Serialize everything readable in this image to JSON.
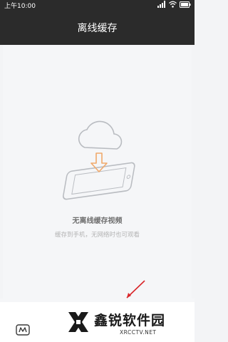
{
  "status_bar": {
    "time": "上午10:00"
  },
  "header": {
    "title": "离线缓存"
  },
  "empty_state": {
    "title": "无离线缓存视频",
    "subtitle": "缓存到手机，无网络时也可观看",
    "icon": "cloud-download-to-phone"
  },
  "bottom_bar": {
    "tab_icon": "video-tab-icon"
  },
  "watermark": {
    "title": "鑫锐软件园",
    "site": "XRCCTV.NET"
  },
  "colors": {
    "header_bg": "#2b2b2b",
    "accent_arrow": "#f0a96b",
    "content_bg": "#f5f6f8",
    "annotation_red": "#d9262a"
  }
}
